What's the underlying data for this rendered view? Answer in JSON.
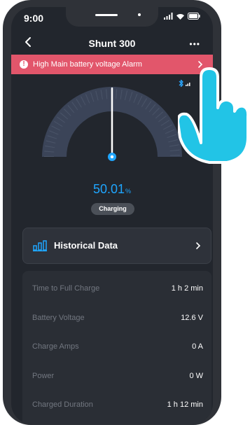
{
  "status_bar": {
    "time": "9:00"
  },
  "header": {
    "title": "Shunt 300"
  },
  "alarm": {
    "text": "High Main battery voltage Alarm"
  },
  "gauge": {
    "percent": "50.01",
    "unit": "%",
    "state": "Charging",
    "fill_fraction": 0.5
  },
  "historical": {
    "label": "Historical Data"
  },
  "stats": [
    {
      "label": "Time to Full Charge",
      "value": "1 h 2 min"
    },
    {
      "label": "Battery Voltage",
      "value": "12.6 V"
    },
    {
      "label": "Charge Amps",
      "value": "0 A"
    },
    {
      "label": "Power",
      "value": "0 W"
    },
    {
      "label": "Charged Duration",
      "value": "1 h 12 min"
    }
  ],
  "colors": {
    "accent": "#1fa6ff",
    "alarm": "#e2566b",
    "background": "#22262d",
    "hand": "#22c4e6"
  }
}
